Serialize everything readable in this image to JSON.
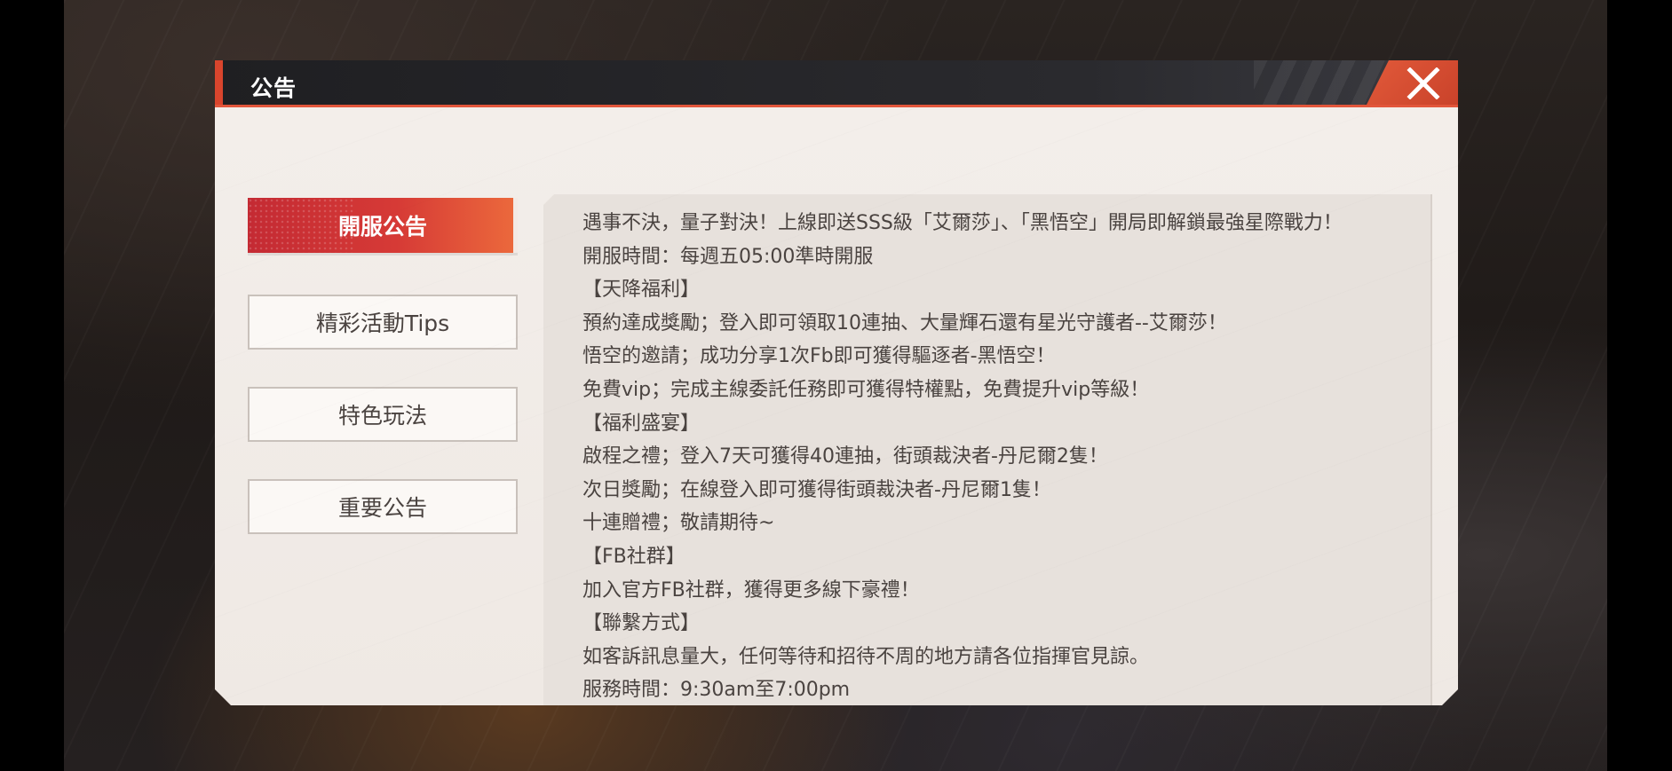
{
  "dialog": {
    "title": "公告",
    "close_icon": "close-x-icon"
  },
  "tabs": [
    {
      "label": "開服公告",
      "active": true
    },
    {
      "label": "精彩活動Tips",
      "active": false
    },
    {
      "label": "特色玩法",
      "active": false
    },
    {
      "label": "重要公告",
      "active": false
    }
  ],
  "content": {
    "lines": [
      "遇事不決，量子對決！上線即送SSS級「艾爾莎」、「黑悟空」開局即解鎖最強星際戰力！",
      "開服時間：每週五05:00準時開服",
      "【天降福利】",
      "預約達成獎勵；登入即可領取10連抽、大量輝石還有星光守護者--艾爾莎！",
      "悟空的邀請；成功分享1次Fb即可獲得驅逐者-黑悟空！",
      "免費vip；完成主線委託任務即可獲得特權點，免費提升vip等級！",
      "【福利盛宴】",
      "啟程之禮；登入7天可獲得40連抽，街頭裁決者-丹尼爾2隻！",
      "次日獎勵；在線登入即可獲得街頭裁決者-丹尼爾1隻！",
      "十連贈禮；敬請期待~",
      "【FB社群】",
      "加入官方FB社群，獲得更多線下豪禮！",
      "【聯繫方式】",
      "如客訴訊息量大，任何等待和招待不周的地方請各位指揮官見諒。",
      "服務時間：9:30am至7:00pm"
    ]
  },
  "colors": {
    "accent": "#d9452d",
    "active_tab": "#c42a33",
    "panel": "#f3eeea",
    "content_bg": "#e7e1dc",
    "text": "#4a4340"
  }
}
